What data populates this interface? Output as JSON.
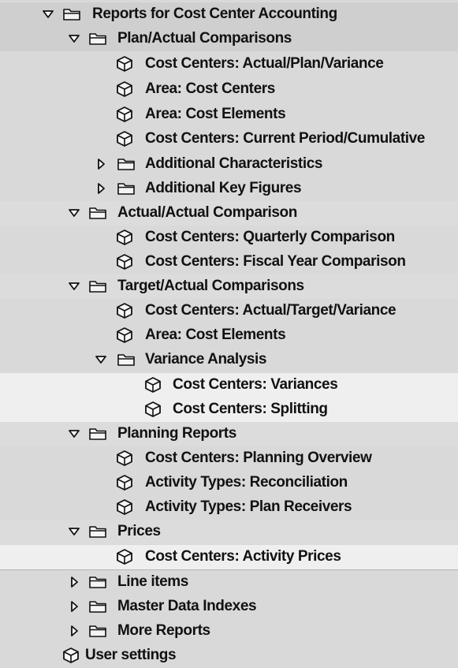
{
  "tree": [
    {
      "label": "Reports for Cost Center Accounting",
      "type": "folder",
      "expanded": true,
      "level": 0
    },
    {
      "label": "Plan/Actual Comparisons",
      "type": "folder",
      "expanded": true,
      "level": 1
    },
    {
      "label": "Cost Centers: Actual/Plan/Variance",
      "type": "report",
      "level": 2
    },
    {
      "label": "Area: Cost Centers",
      "type": "report",
      "level": 2
    },
    {
      "label": "Area: Cost Elements",
      "type": "report",
      "level": 2
    },
    {
      "label": "Cost Centers: Current Period/Cumulative",
      "type": "report",
      "level": 2
    },
    {
      "label": "Additional Characteristics",
      "type": "folder",
      "expanded": false,
      "level": 2
    },
    {
      "label": "Additional Key Figures",
      "type": "folder",
      "expanded": false,
      "level": 2
    },
    {
      "label": "Actual/Actual Comparison",
      "type": "folder",
      "expanded": true,
      "level": 1
    },
    {
      "label": "Cost Centers: Quarterly Comparison",
      "type": "report",
      "level": 2
    },
    {
      "label": "Cost Centers: Fiscal Year Comparison",
      "type": "report",
      "level": 2
    },
    {
      "label": "Target/Actual Comparisons",
      "type": "folder",
      "expanded": true,
      "level": 1
    },
    {
      "label": "Cost Centers: Actual/Target/Variance",
      "type": "report",
      "level": 2
    },
    {
      "label": "Area: Cost Elements",
      "type": "report",
      "level": 2
    },
    {
      "label": "Variance Analysis",
      "type": "folder",
      "expanded": true,
      "level": 2
    },
    {
      "label": "Cost Centers: Variances",
      "type": "report",
      "level": 3
    },
    {
      "label": "Cost Centers: Splitting",
      "type": "report",
      "level": 3
    },
    {
      "label": "Planning Reports",
      "type": "folder",
      "expanded": true,
      "level": 1
    },
    {
      "label": "Cost Centers: Planning Overview",
      "type": "report",
      "level": 2
    },
    {
      "label": "Activity Types: Reconciliation",
      "type": "report",
      "level": 2
    },
    {
      "label": "Activity Types: Plan Receivers",
      "type": "report",
      "level": 2
    },
    {
      "label": "Prices",
      "type": "folder",
      "expanded": true,
      "level": 1
    },
    {
      "label": "Cost Centers: Activity Prices",
      "type": "report",
      "level": 2
    },
    {
      "label": "Line items",
      "type": "folder",
      "expanded": false,
      "level": 1
    },
    {
      "label": "Master Data Indexes",
      "type": "folder",
      "expanded": false,
      "level": 1
    },
    {
      "label": "More Reports",
      "type": "folder",
      "expanded": false,
      "level": 1
    },
    {
      "label": "User settings",
      "type": "report",
      "level": 1
    }
  ],
  "icons": {
    "folder": "folder-icon",
    "report": "report-cube-icon",
    "expanded_toggle": "triangle-down-icon",
    "collapsed_toggle": "triangle-right-icon"
  },
  "colors": {
    "header_band": "#cfcfcf",
    "group_band": "#dcdcdc",
    "highlight_band": "#efefef",
    "text": "#111111"
  }
}
